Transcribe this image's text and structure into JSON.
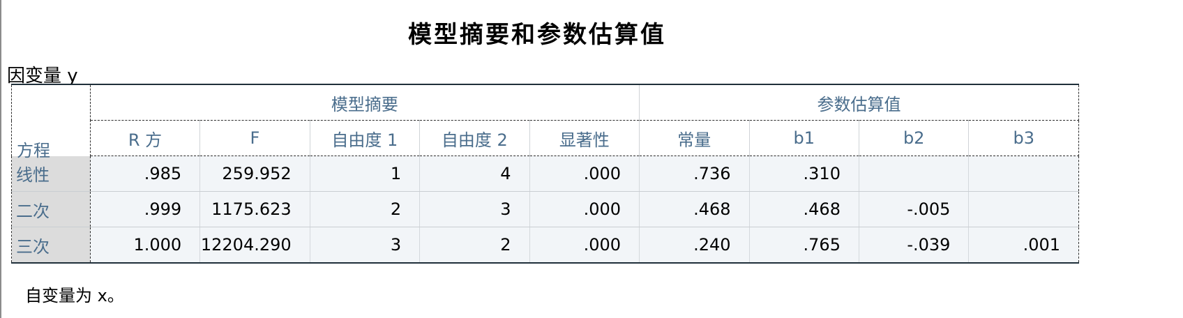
{
  "title": "模型摘要和参数估算值",
  "dependent_variable": "因变量 y",
  "group_headers": {
    "model_summary": "模型摘要",
    "parameters": "参数估算值"
  },
  "columns": {
    "equation": "方程",
    "r_square": "R 方",
    "f": "F",
    "df1": "自由度 1",
    "df2": "自由度 2",
    "sig": "显著性",
    "constant": "常量",
    "b1": "b1",
    "b2": "b2",
    "b3": "b3"
  },
  "rows": [
    {
      "equation": "线性",
      "r_square": ".985",
      "f": "259.952",
      "df1": "1",
      "df2": "4",
      "sig": ".000",
      "constant": ".736",
      "b1": ".310",
      "b2": "",
      "b3": ""
    },
    {
      "equation": "二次",
      "r_square": ".999",
      "f": "1175.623",
      "df1": "2",
      "df2": "3",
      "sig": ".000",
      "constant": ".468",
      "b1": ".468",
      "b2": "-.005",
      "b3": ""
    },
    {
      "equation": "三次",
      "r_square": "1.000",
      "f": "12204.290",
      "df1": "3",
      "df2": "2",
      "sig": ".000",
      "constant": ".240",
      "b1": ".765",
      "b2": "-.039",
      "b3": ".001"
    }
  ],
  "footnote": "自变量为 x。"
}
